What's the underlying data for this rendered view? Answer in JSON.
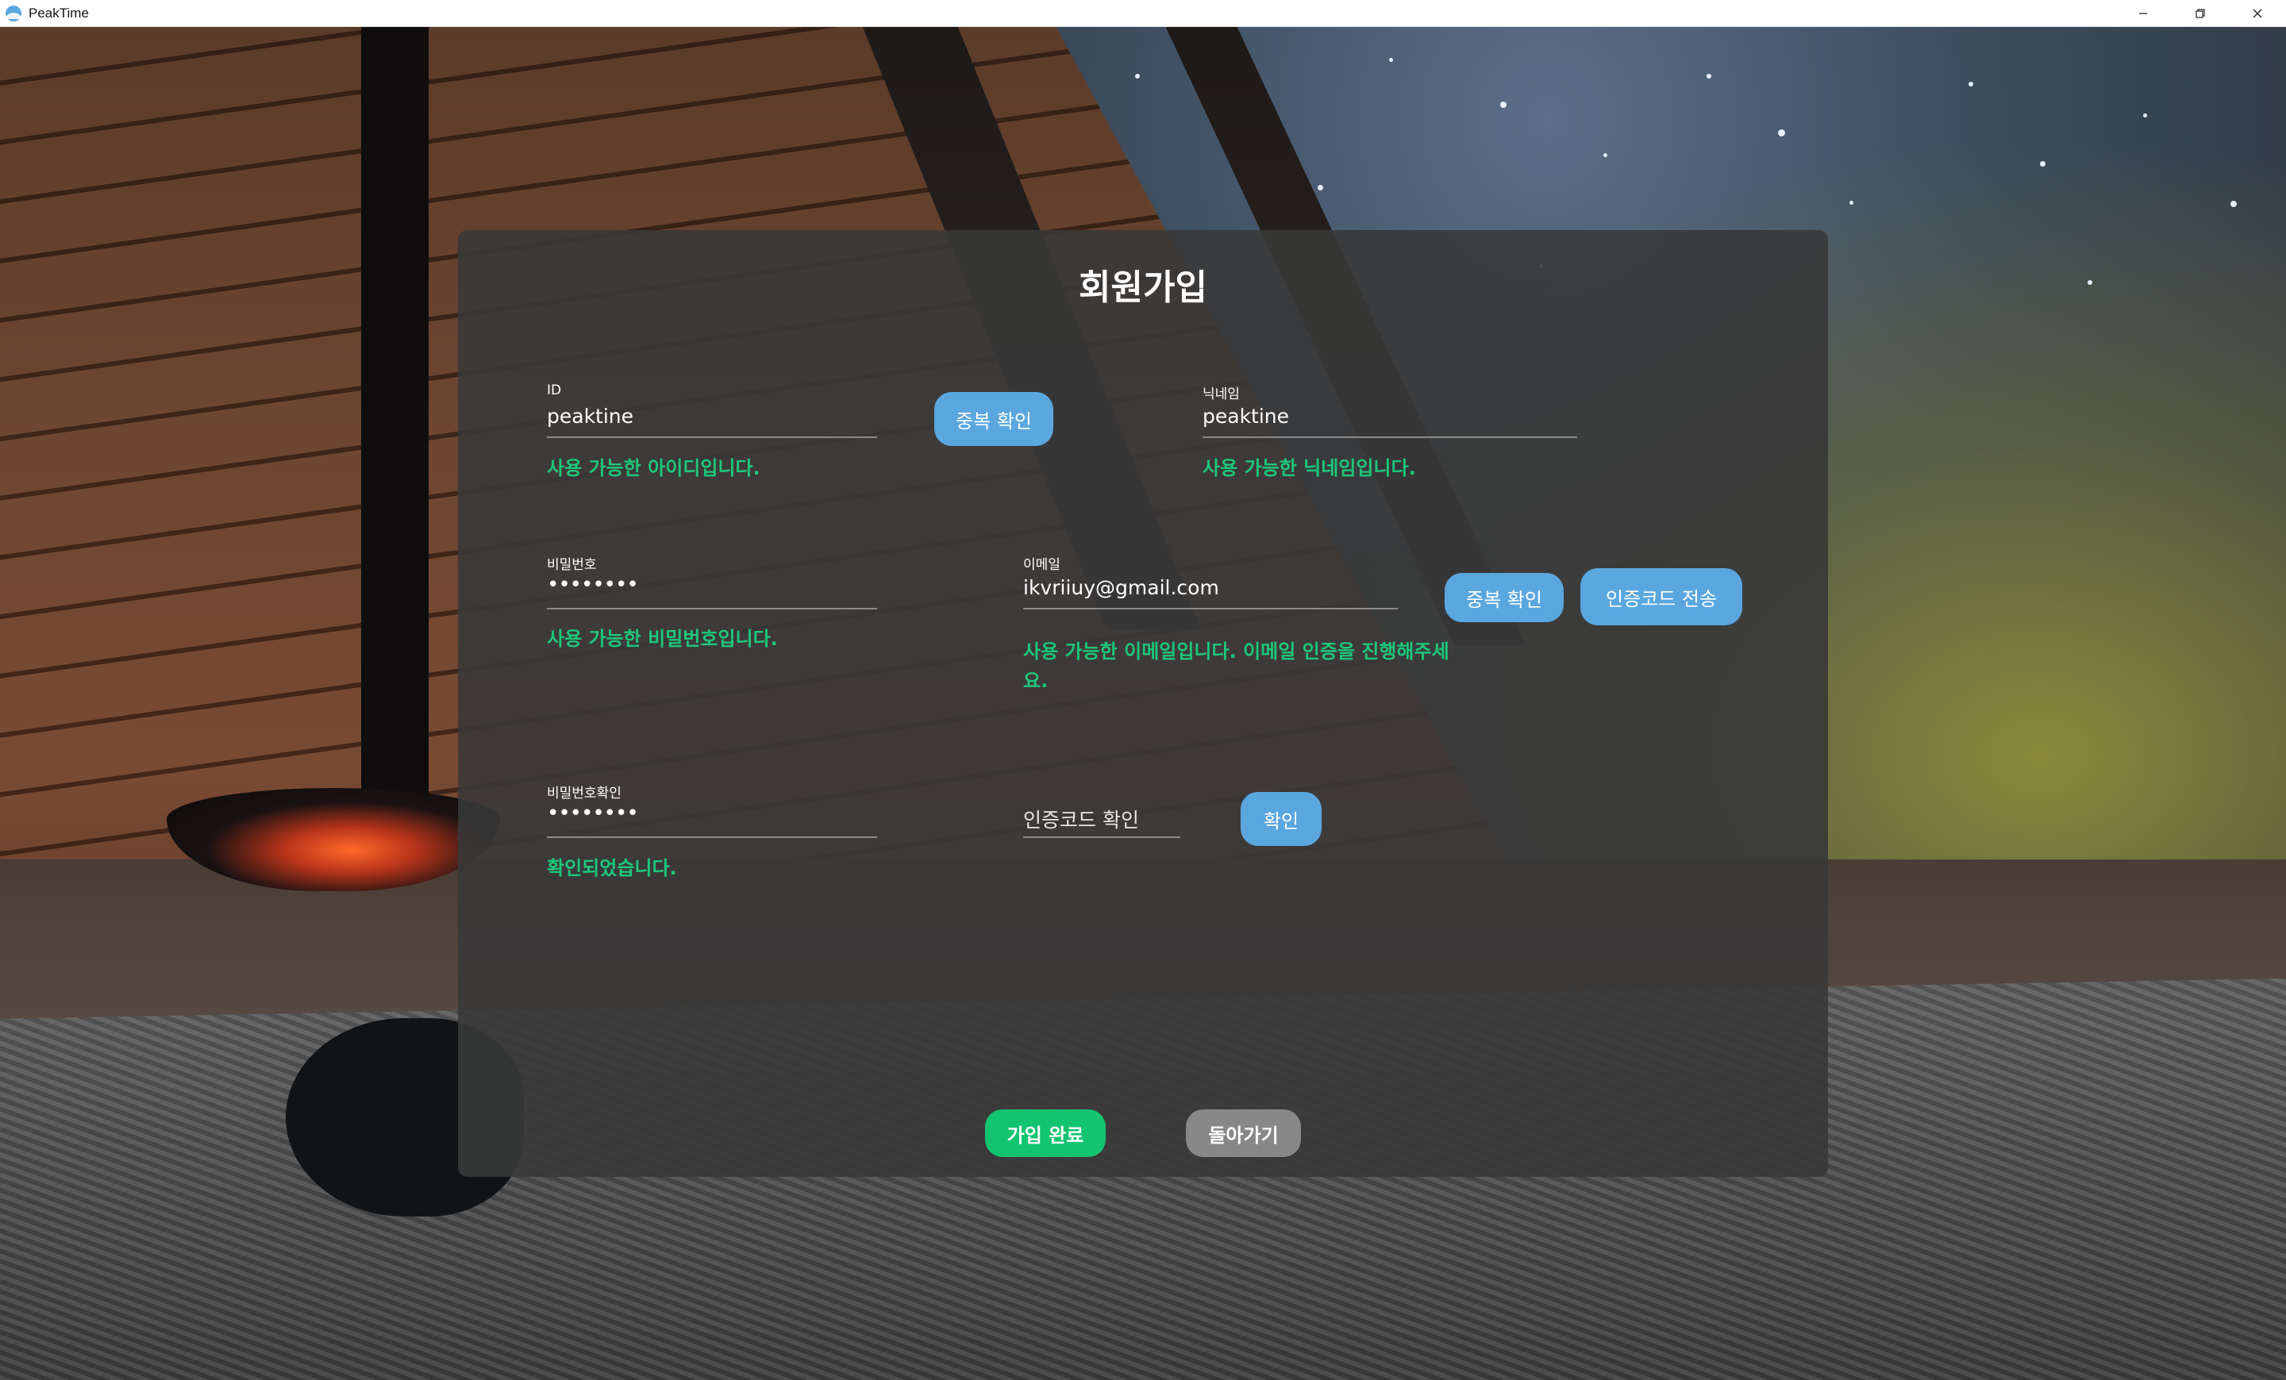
{
  "window": {
    "title": "PeakTime"
  },
  "signup": {
    "title": "회원가입",
    "id": {
      "label": "ID",
      "value": "peaktine",
      "check_button": "중복 확인",
      "message": "사용 가능한 아이디입니다."
    },
    "nickname": {
      "label": "닉네임",
      "value": "peaktine",
      "message": "사용 가능한 닉네임입니다."
    },
    "password": {
      "label": "비밀번호",
      "value": "••••••••",
      "message": "사용 가능한 비밀번호입니다."
    },
    "email": {
      "label": "이메일",
      "value": "ikvriiuy@gmail.com",
      "check_button": "중복 확인",
      "send_code_button": "인증코드 전송",
      "message_line1": "사용 가능한 이메일입니다. 이메일 인증을 진행해주세",
      "message_line2": "요."
    },
    "password_confirm": {
      "label": "비밀번호확인",
      "value": "••••••••",
      "message": "확인되었습니다."
    },
    "verify_code": {
      "placeholder": "인증코드 확인",
      "confirm_button": "확인"
    },
    "submit_button": "가입 완료",
    "back_button": "돌아가기"
  },
  "colors": {
    "success": "#1cc77a",
    "button_blue": "#5aa7e0",
    "button_green": "#12c46f",
    "button_gray": "#888888",
    "panel": "#383838"
  }
}
